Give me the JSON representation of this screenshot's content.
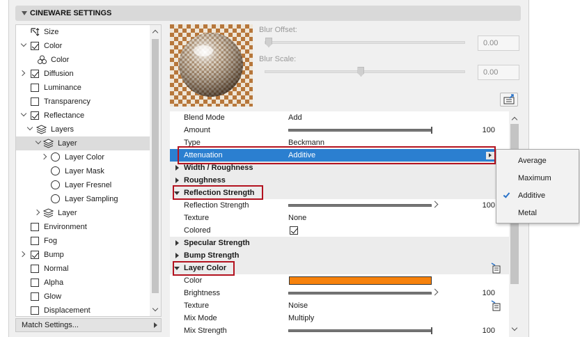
{
  "header": {
    "title": "CINEWARE SETTINGS"
  },
  "tree": {
    "items": [
      {
        "label": "Size",
        "icon": "size-icon"
      },
      {
        "label": "Color",
        "checked": true
      },
      {
        "label": "Color",
        "icon": "color-channels-icon"
      },
      {
        "label": "Diffusion",
        "checked": true
      },
      {
        "label": "Luminance",
        "checked": false
      },
      {
        "label": "Transparency",
        "checked": false
      },
      {
        "label": "Reflectance",
        "checked": true
      },
      {
        "label": "Layers",
        "icon": "layers-icon"
      },
      {
        "label": "Layer",
        "icon": "layer-icon",
        "selected": true
      },
      {
        "label": "Layer Color"
      },
      {
        "label": "Layer Mask"
      },
      {
        "label": "Layer Fresnel"
      },
      {
        "label": "Layer Sampling"
      },
      {
        "label": "Layer",
        "icon": "layer-icon"
      },
      {
        "label": "Environment",
        "checked": false
      },
      {
        "label": "Fog",
        "checked": false
      },
      {
        "label": "Bump",
        "checked": true
      },
      {
        "label": "Normal",
        "checked": false
      },
      {
        "label": "Alpha",
        "checked": false
      },
      {
        "label": "Glow",
        "checked": false
      },
      {
        "label": "Displacement",
        "checked": false
      }
    ],
    "match_settings": "Match Settings..."
  },
  "blur": {
    "offset_label": "Blur Offset:",
    "offset_value": "0.00",
    "offset_level": 0,
    "scale_label": "Blur Scale:",
    "scale_value": "0.00",
    "scale_level": 0.48
  },
  "props": {
    "rows": [
      {
        "label": "Blend Mode",
        "value": "Add"
      },
      {
        "label": "Amount",
        "slider": 1.0,
        "number": "100"
      },
      {
        "label": "Type",
        "value": "Beckmann"
      },
      {
        "label": "Attenuation",
        "value": "Additive",
        "selected": true
      },
      {
        "label": "Width / Roughness",
        "group": true,
        "open": false
      },
      {
        "label": "Roughness",
        "group": true,
        "open": false
      },
      {
        "label": "Reflection Strength",
        "group": true,
        "open": true
      },
      {
        "label": "Reflection Strength",
        "slider": 1.0,
        "number": "100"
      },
      {
        "label": "Texture",
        "value": "None"
      },
      {
        "label": "Colored",
        "checkbox": true
      },
      {
        "label": "Specular Strength",
        "group": true,
        "open": false
      },
      {
        "label": "Bump Strength",
        "group": true,
        "open": false
      },
      {
        "label": "Layer Color",
        "group": true,
        "open": true
      },
      {
        "label": "Color",
        "swatch": "#f7820c"
      },
      {
        "label": "Brightness",
        "slider": 1.0,
        "number": "100"
      },
      {
        "label": "Texture",
        "value": "Noise"
      },
      {
        "label": "Mix Mode",
        "value": "Multiply"
      },
      {
        "label": "Mix Strength",
        "slider": 1.0,
        "number": "100"
      }
    ]
  },
  "popup": {
    "options": [
      {
        "label": "Average",
        "checked": false
      },
      {
        "label": "Maximum",
        "checked": false
      },
      {
        "label": "Additive",
        "checked": true
      },
      {
        "label": "Metal",
        "checked": false
      }
    ]
  },
  "colors": {
    "selection": "#2b7fd0",
    "highlight": "#b3121f",
    "layer_color": "#f7820c"
  }
}
